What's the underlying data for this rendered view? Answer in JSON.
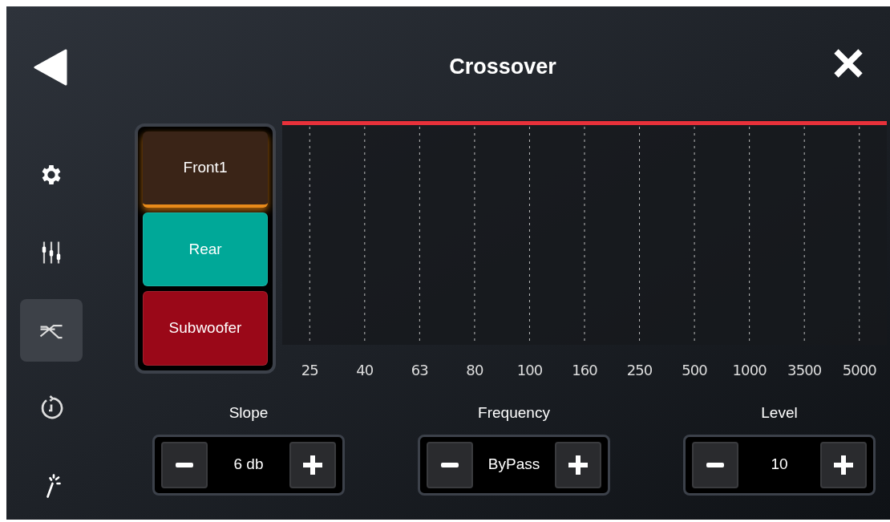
{
  "header": {
    "title": "Crossover"
  },
  "sidebar": {
    "items": [
      {
        "kind": "settings",
        "selected": false
      },
      {
        "kind": "equalizer",
        "selected": false
      },
      {
        "kind": "crossover",
        "selected": true
      },
      {
        "kind": "history",
        "selected": false
      },
      {
        "kind": "effects",
        "selected": false
      }
    ]
  },
  "channels": [
    {
      "label": "Front1",
      "selected": true,
      "color": "#3a2417"
    },
    {
      "label": "Rear",
      "selected": false,
      "color": "#00a898"
    },
    {
      "label": "Subwoofer",
      "selected": false,
      "color": "#9a0818"
    }
  ],
  "graph": {
    "frequency_labels": [
      "25",
      "40",
      "63",
      "80",
      "100",
      "160",
      "250",
      "500",
      "1000",
      "3500",
      "5000"
    ]
  },
  "controls": [
    {
      "label": "Slope",
      "value": "6 db"
    },
    {
      "label": "Frequency",
      "value": "ByPass"
    },
    {
      "label": "Level",
      "value": "10"
    }
  ]
}
